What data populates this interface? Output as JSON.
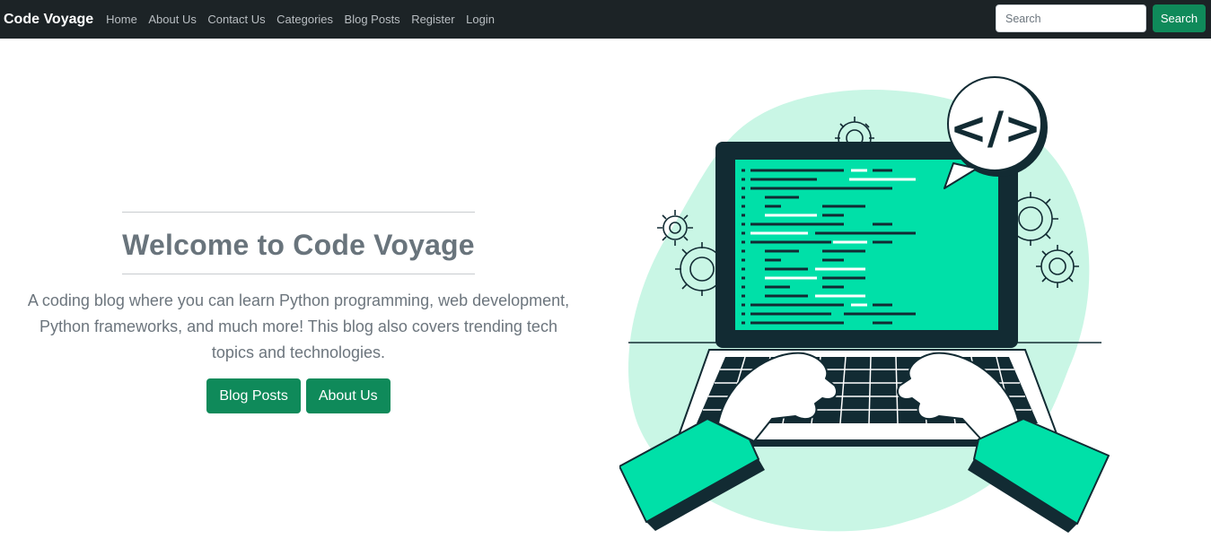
{
  "navbar": {
    "brand": "Code Voyage",
    "links": [
      "Home",
      "About Us",
      "Contact Us",
      "Categories",
      "Blog Posts",
      "Register",
      "Login"
    ],
    "search": {
      "placeholder": "Search",
      "value": "",
      "button_label": "Search"
    }
  },
  "hero": {
    "title": "Welcome to Code Voyage",
    "description": "A coding blog where you can learn Python programming, web development, Python frameworks, and much more! This blog also covers trending tech topics and technologies.",
    "buttons": {
      "blog_posts": "Blog Posts",
      "about_us": "About Us"
    }
  },
  "illustration": {
    "code_badge": "</>",
    "colors": {
      "accent": "#00e0a8",
      "dark": "#122b33",
      "blob": "#c9f6e5",
      "brand_button": "#0f8a5a",
      "navbar": "#1c2326"
    }
  }
}
